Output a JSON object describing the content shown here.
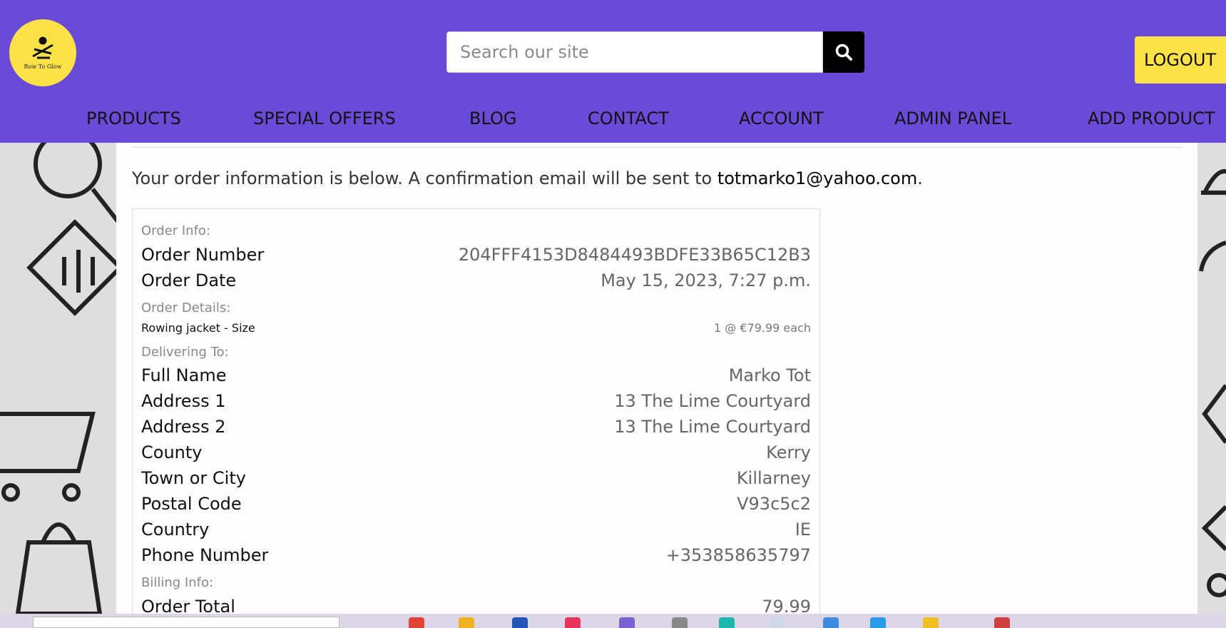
{
  "header": {
    "logo_text": "Row To Glow",
    "search_placeholder": "Search our site",
    "logout_label": "LOGOUT"
  },
  "nav": {
    "items": [
      "PRODUCTS",
      "SPECIAL OFFERS",
      "BLOG",
      "CONTACT",
      "ACCOUNT",
      "ADMIN PANEL",
      "ADD PRODUCT"
    ]
  },
  "intro": {
    "text": "Your order information is below. A confirmation email will be sent to ",
    "email": "totmarko1@yahoo.com",
    "end": "."
  },
  "order": {
    "order_info_label": "Order Info:",
    "order_number_label": "Order Number",
    "order_number": "204FFF4153D8484493BDFE33B65C12B3",
    "order_date_label": "Order Date",
    "order_date": "May 15, 2023, 7:27 p.m.",
    "order_details_label": "Order Details:",
    "item_name": "Rowing jacket - Size",
    "item_qty": "1 @ €79.99 each",
    "delivering_label": "Delivering To:",
    "full_name_label": "Full Name",
    "full_name": "Marko Tot",
    "address1_label": "Address 1",
    "address1": "13 The Lime Courtyard",
    "address2_label": "Address 2",
    "address2": "13 The Lime Courtyard",
    "county_label": "County",
    "county": "Kerry",
    "town_label": "Town or City",
    "town": "Killarney",
    "postal_label": "Postal Code",
    "postal": "V93c5c2",
    "country_label": "Country",
    "country": "IE",
    "phone_label": "Phone Number",
    "phone": "+353858635797",
    "billing_label": "Billing Info:",
    "total_label": "Order Total",
    "total": "79.99"
  },
  "colors": {
    "header_bg": "#6a4bd8",
    "logo_bg": "#fde247",
    "logout_bg": "#fde247",
    "search_btn_bg": "#000000"
  },
  "icons": [
    "rower-logo-icon",
    "search-icon"
  ]
}
